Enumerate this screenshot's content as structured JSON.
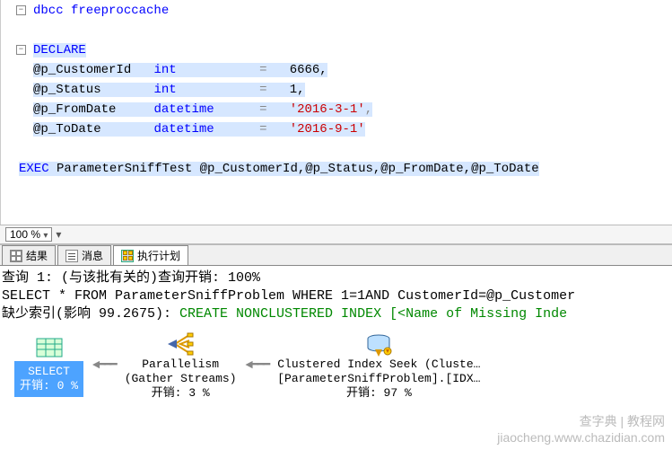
{
  "code": {
    "l1": "dbcc freeproccache",
    "decl": "DECLARE",
    "p1_name": "@p_CustomerId",
    "p1_type": "int",
    "p1_eq": "=",
    "p1_val": "6666,",
    "p2_name": "@p_Status",
    "p2_type": "int",
    "p2_eq": "=",
    "p2_val": "1,",
    "p3_name": "@p_FromDate",
    "p3_type": "datetime",
    "p3_eq": "=",
    "p3_val": "'2016-3-1'",
    "p3_comma": ",",
    "p4_name": "@p_ToDate",
    "p4_type": "datetime",
    "p4_eq": "=",
    "p4_val": "'2016-9-1'",
    "exec_kw": "EXEC",
    "exec_body": " ParameterSniffTest @p_CustomerId,@p_Status,@p_FromDate,@p_ToDate"
  },
  "zoom": {
    "value": "100 %"
  },
  "tabs": {
    "results": "结果",
    "messages": "消息",
    "plan": "执行计划"
  },
  "results": {
    "line1": "查询 1: (与该批有关的)查询开销: 100%",
    "line2": "SELECT * FROM ParameterSniffProblem WHERE 1=1AND CustomerId=@p_Customer",
    "line3a": "缺少索引(影响 99.2675): ",
    "line3b": "CREATE NONCLUSTERED INDEX [<Name of Missing Inde"
  },
  "plan": {
    "select_label": "SELECT",
    "select_cost": "开销: 0 %",
    "para_l1": "Parallelism",
    "para_l2": "(Gather Streams)",
    "para_cost": "开销: 3 %",
    "seek_l1": "Clustered Index Seek (Cluste…",
    "seek_l2": "[ParameterSniffProblem].[IDX…",
    "seek_cost": "开销: 97 %"
  },
  "watermark": "查字典 | 教程网\njiaocheng.www.chazidian.com"
}
